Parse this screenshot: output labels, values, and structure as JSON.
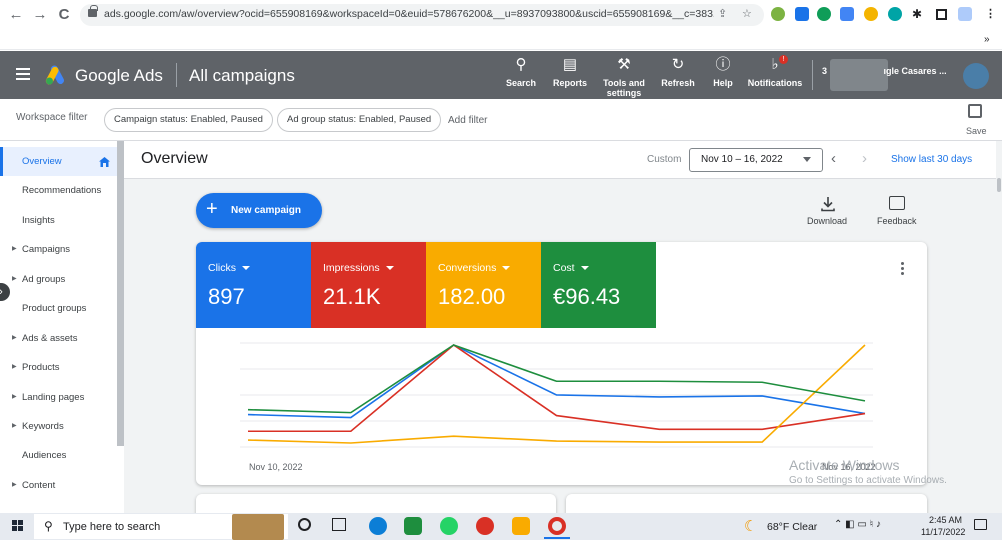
{
  "browser": {
    "back": "←",
    "forward": "→",
    "reload": "C",
    "url": "ads.google.com/aw/overview?ocid=655908169&workspaceId=0&euid=578676200&__u=8937093800&uscid=655908169&__c=383...",
    "bookmarks_more": "»"
  },
  "header": {
    "brand": "Google Ads",
    "title": "All campaigns",
    "tools": [
      {
        "label": "Search",
        "icon": "search-icon"
      },
      {
        "label": "Reports",
        "icon": "reports-icon"
      },
      {
        "label": "Tools and settings",
        "icon": "wrench-icon"
      },
      {
        "label": "Refresh",
        "icon": "refresh-icon"
      },
      {
        "label": "Help",
        "icon": "help-icon"
      },
      {
        "label": "Notifications",
        "icon": "bell-icon"
      }
    ],
    "notification_count": "!",
    "account_prefix": "3",
    "account_name": "ıgle Casares ..."
  },
  "filters": {
    "label": "Workspace filter",
    "chips": [
      "Campaign status: Enabled, Paused",
      "Ad group status: Enabled, Paused"
    ],
    "add": "Add filter",
    "save": "Save"
  },
  "sidebar": {
    "items": [
      {
        "label": "Overview",
        "caret": false
      },
      {
        "label": "Recommendations",
        "caret": false
      },
      {
        "label": "Insights",
        "caret": false
      },
      {
        "label": "Campaigns",
        "caret": true
      },
      {
        "label": "Ad groups",
        "caret": true
      },
      {
        "label": "Product groups",
        "caret": false
      },
      {
        "label": "Ads & assets",
        "caret": true
      },
      {
        "label": "Products",
        "caret": true
      },
      {
        "label": "Landing pages",
        "caret": true
      },
      {
        "label": "Keywords",
        "caret": true
      },
      {
        "label": "Audiences",
        "caret": false
      },
      {
        "label": "Content",
        "caret": true
      }
    ]
  },
  "overview": {
    "title": "Overview",
    "custom": "Custom",
    "date_range": "Nov 10 – 16, 2022",
    "show_last": "Show last 30 days",
    "new_campaign": "New campaign",
    "download": "Download",
    "feedback": "Feedback"
  },
  "metrics": [
    {
      "label": "Clicks",
      "value": "897",
      "color": "#1a73e8"
    },
    {
      "label": "Impressions",
      "value": "21.1K",
      "color": "#d93025"
    },
    {
      "label": "Conversions",
      "value": "182.00",
      "color": "#f9ab00"
    },
    {
      "label": "Cost",
      "value": "€96.43",
      "color": "#1e8e3e"
    }
  ],
  "chart_data": {
    "type": "line",
    "x": [
      "Nov 10, 2022",
      "Nov 11, 2022",
      "Nov 12, 2022",
      "Nov 13, 2022",
      "Nov 14, 2022",
      "Nov 15, 2022",
      "Nov 16, 2022"
    ],
    "x_tick_labels": [
      "Nov 10, 2022",
      "Nov 16, 2022"
    ],
    "series": [
      {
        "name": "Clicks",
        "color": "#1a73e8",
        "values": [
          0.29,
          0.26,
          1.0,
          0.49,
          0.47,
          0.48,
          0.3
        ]
      },
      {
        "name": "Impressions",
        "color": "#d93025",
        "values": [
          0.12,
          0.12,
          1.0,
          0.28,
          0.14,
          0.14,
          0.3
        ]
      },
      {
        "name": "Conversions",
        "color": "#f9ab00",
        "values": [
          0.03,
          0.0,
          0.07,
          0.02,
          0.01,
          0.01,
          1.0
        ]
      },
      {
        "name": "Cost",
        "color": "#1e8e3e",
        "values": [
          0.34,
          0.31,
          1.0,
          0.63,
          0.63,
          0.62,
          0.43
        ]
      }
    ],
    "grid": true,
    "legend": "none"
  },
  "watermark": {
    "line1": "Activate Windows",
    "line2": "Go to Settings to activate Windows."
  },
  "taskbar": {
    "search": "Type here to search",
    "weather": "68°F  Clear",
    "time": "2:45 AM",
    "date": "11/17/2022"
  }
}
